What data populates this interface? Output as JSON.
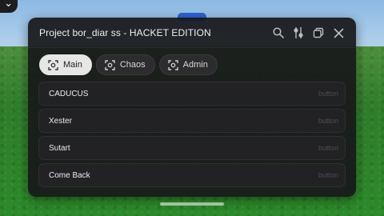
{
  "window": {
    "title": "Project bor_diar ss - HACKET EDITION"
  },
  "titlebar_icons": [
    "search-icon",
    "sliders-icon",
    "copy-icon",
    "close-icon"
  ],
  "tabs": [
    {
      "label": "Main",
      "icon": "scan-icon",
      "active": true
    },
    {
      "label": "Chaos",
      "icon": "scan-icon",
      "active": false
    },
    {
      "label": "Admin",
      "icon": "scan-icon",
      "active": false
    }
  ],
  "items": [
    {
      "label": "CADUCUS",
      "hint": "button"
    },
    {
      "label": "Xester",
      "hint": "button"
    },
    {
      "label": "Sutart",
      "hint": "button"
    },
    {
      "label": "Come Back",
      "hint": "button"
    }
  ],
  "colors": {
    "panel": "#18181a",
    "active_tab": "#e6e6e6",
    "grass": "#2f7d2a"
  }
}
